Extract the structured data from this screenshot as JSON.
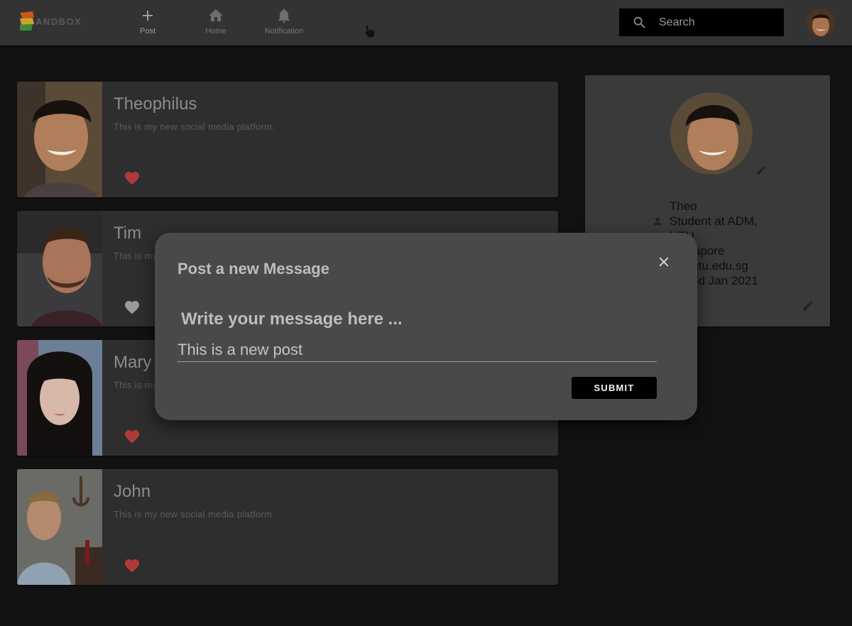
{
  "header": {
    "logo_text": "ANDBOX",
    "nav": [
      {
        "label": "Post",
        "icon": "plus-icon"
      },
      {
        "label": "Home",
        "icon": "home-icon"
      },
      {
        "label": "Notification",
        "icon": "bell-icon"
      }
    ],
    "search_placeholder": "Search"
  },
  "posts": [
    {
      "name": "Theophilus",
      "text": "This is my new social media platform.",
      "liked": true
    },
    {
      "name": "Tim",
      "text": "This is my new social media platform.",
      "liked": false
    },
    {
      "name": "Mary",
      "text": "This is my new social media platform.",
      "liked": true
    },
    {
      "name": "John",
      "text": "This is my new social media platform.",
      "liked": true
    }
  ],
  "profile": {
    "name": "Theo",
    "line2": "Student at ADM,",
    "line3": "NTU",
    "line4": "Singapore",
    "line5": "@e.ntu.edu.sg",
    "line6": "Joined Jan 2021"
  },
  "modal": {
    "title": "Post a new Message",
    "label": "Write your message here ...",
    "input_value": "This is a new post",
    "submit_label": "SUBMIT"
  },
  "colors": {
    "like_active": "#b03a3a",
    "like_inactive": "#9a9a9a",
    "logo_yellow": "#c9a227",
    "logo_green": "#3d8a3d",
    "logo_orange": "#c75a1a"
  }
}
